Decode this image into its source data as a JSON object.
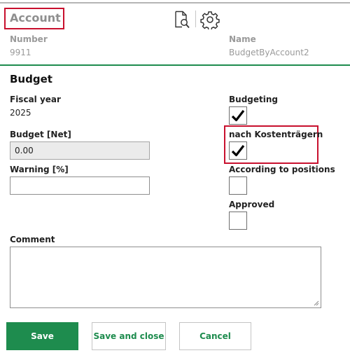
{
  "header": {
    "title": "Account",
    "doc_search_icon": "document-search-icon",
    "settings_icon": "gear-icon"
  },
  "account": {
    "number_label": "Number",
    "number_value": "9911",
    "name_label": "Name",
    "name_value": "BudgetByAccount2"
  },
  "budget": {
    "section_title": "Budget",
    "fiscal_year_label": "Fiscal year",
    "fiscal_year_value": "2025",
    "budget_net_label": "Budget [Net]",
    "budget_net_value": "0.00",
    "warning_label": "Warning [%]",
    "warning_value": "",
    "budgeting_label": "Budgeting",
    "budgeting_checked": true,
    "kostentraeger_label": "nach Kostenträgern",
    "kostentraeger_checked": true,
    "according_positions_label": "According to positions",
    "according_positions_checked": false,
    "approved_label": "Approved",
    "approved_checked": false,
    "comment_label": "Comment",
    "comment_value": ""
  },
  "buttons": {
    "save": "Save",
    "save_and_close": "Save and close",
    "cancel": "Cancel"
  },
  "colors": {
    "accent_green": "#1e8c4e",
    "highlight_red": "#c8102e",
    "muted_grey": "#9a9a9a"
  }
}
